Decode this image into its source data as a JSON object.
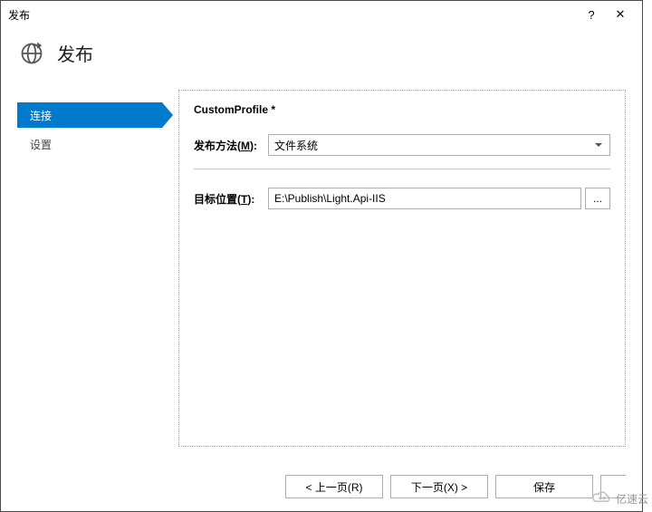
{
  "titlebar": {
    "title": "发布",
    "help_label": "?",
    "close_label": "✕"
  },
  "header": {
    "title": "发布"
  },
  "sidebar": {
    "items": [
      {
        "label": "连接",
        "active": true
      },
      {
        "label": "设置",
        "active": false
      }
    ]
  },
  "content": {
    "profile_title": "CustomProfile *",
    "method_label_prefix": "发布方法(",
    "method_label_accel": "M",
    "method_label_suffix": "):",
    "method_value": "文件系统",
    "target_label_prefix": "目标位置(",
    "target_label_accel": "T",
    "target_label_suffix": "):",
    "target_value": "E:\\Publish\\Light.Api-IIS",
    "browse_label": "..."
  },
  "footer": {
    "back_label": "< 上一页(R)",
    "next_label": "下一页(X) >",
    "save_label": "保存"
  },
  "watermark": {
    "text": "亿速云"
  }
}
